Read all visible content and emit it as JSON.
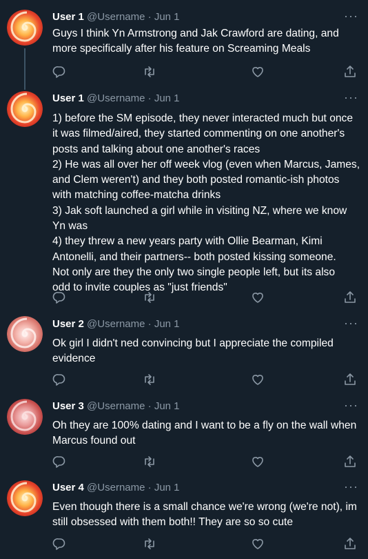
{
  "tweets": [
    {
      "name": "User 1",
      "handle": "@Username",
      "dot": "·",
      "date": "Jun 1",
      "more": "···",
      "avatar_icon": "swirl-avatar-orange",
      "text": "Guys I think Yn Armstrong and Jak Crawford are dating, and\nmore specifically after his feature on Screaming Meals"
    },
    {
      "name": "User 1",
      "handle": "@Username",
      "dot": "·",
      "date": "Jun 1",
      "more": "···",
      "avatar_icon": "swirl-avatar-orange",
      "text": "1) before the SM episode, they never interacted much but once\nit was filmed/aired, they started commenting on one another's\nposts and talking about one another's races\n2) He was all over her off week vlog (even when Marcus, James,\nand Clem weren't) and they both posted romantic-ish photos\nwith matching coffee-matcha drinks\n3) Jak soft launched a girl while in visiting NZ, where we know\nYn was\n4) they threw a new years party with Ollie Bearman, Kimi\nAntonelli, and their partners-- both posted kissing someone.\nNot only are they the only two single people left, but its also\nodd to invite couples as \"just friends\""
    },
    {
      "name": "User 2",
      "handle": "@Username",
      "dot": "·",
      "date": "Jun 1",
      "more": "···",
      "avatar_icon": "swirl-avatar-pink",
      "text": "Ok girl I didn't ned convincing but I appreciate the compiled\nevidence"
    },
    {
      "name": "User 3",
      "handle": "@Username",
      "dot": "·",
      "date": "Jun 1",
      "more": "···",
      "avatar_icon": "swirl-avatar-red",
      "text": "Oh they are 100% dating and I want to be a fly on the wall when\nMarcus found out"
    },
    {
      "name": "User 4",
      "handle": "@Username",
      "dot": "·",
      "date": "Jun 1",
      "more": "···",
      "avatar_icon": "swirl-avatar-orange",
      "text": "Even though there is a small chance we're wrong (we're not), im\nstill obsessed with them both!! They are so so cute"
    }
  ],
  "colors": {
    "background": "#15202b",
    "text": "#ffffff",
    "secondary": "#8b98a5",
    "thread_line": "#3d5466"
  },
  "action_icons": [
    "reply-icon",
    "retweet-icon",
    "like-icon",
    "share-icon"
  ]
}
